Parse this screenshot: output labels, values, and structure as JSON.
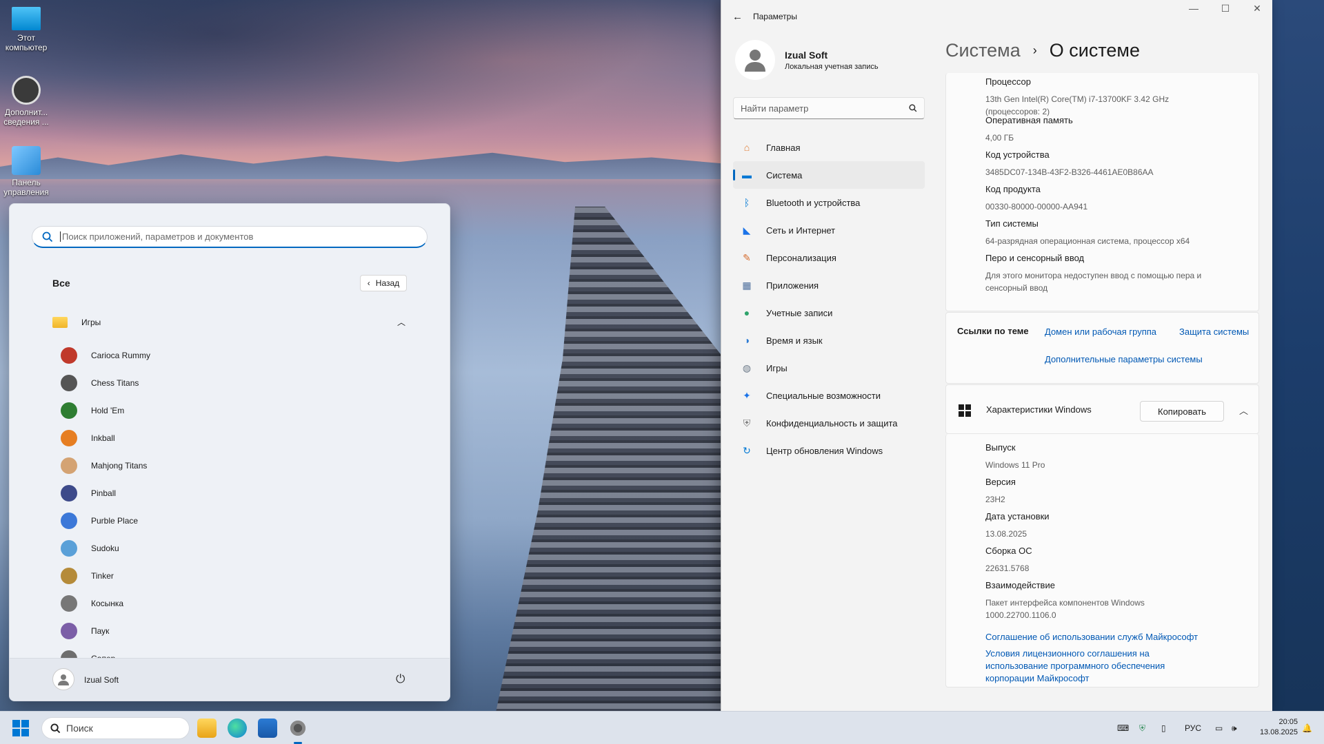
{
  "desktop": {
    "icons": [
      {
        "label": "Этот компьютер"
      },
      {
        "label": "Дополнит... сведения ..."
      },
      {
        "label": "Панель управления"
      }
    ]
  },
  "start_menu": {
    "search_placeholder": "Поиск приложений, параметров и документов",
    "all_label": "Все",
    "back_label": "Назад",
    "folder_label": "Игры",
    "games": [
      {
        "label": "Carioca Rummy",
        "color": "#c0392b"
      },
      {
        "label": "Chess Titans",
        "color": "#555555"
      },
      {
        "label": "Hold 'Em",
        "color": "#2e7d32"
      },
      {
        "label": "Inkball",
        "color": "#e67e22"
      },
      {
        "label": "Mahjong Titans",
        "color": "#d4a373"
      },
      {
        "label": "Pinball",
        "color": "#3d4a8a"
      },
      {
        "label": "Purble Place",
        "color": "#3c78d8"
      },
      {
        "label": "Sudoku",
        "color": "#5aa0d8"
      },
      {
        "label": "Tinker",
        "color": "#b58b3a"
      },
      {
        "label": "Косынка",
        "color": "#777777"
      },
      {
        "label": "Паук",
        "color": "#7b5ea7"
      },
      {
        "label": "Сапер",
        "color": "#6e6e6e"
      }
    ],
    "user_name": "Izual Soft"
  },
  "settings": {
    "window_title": "Параметры",
    "profile": {
      "name": "Izual Soft",
      "account_type": "Локальная учетная запись"
    },
    "search_placeholder": "Найти параметр",
    "nav": [
      {
        "label": "Главная",
        "icon": "home-icon",
        "glyph": "⌂",
        "color": "#e07a2f"
      },
      {
        "label": "Система",
        "icon": "system-icon",
        "glyph": "▬",
        "color": "#0078d4",
        "active": true
      },
      {
        "label": "Bluetooth и устройства",
        "icon": "bluetooth-icon",
        "glyph": "ᛒ",
        "color": "#0078d4"
      },
      {
        "label": "Сеть и Интернет",
        "icon": "wifi-icon",
        "glyph": "◣",
        "color": "#1a73e8"
      },
      {
        "label": "Персонализация",
        "icon": "brush-icon",
        "glyph": "✎",
        "color": "#d56b2d"
      },
      {
        "label": "Приложения",
        "icon": "apps-icon",
        "glyph": "▦",
        "color": "#4a6c9b"
      },
      {
        "label": "Учетные записи",
        "icon": "account-icon",
        "glyph": "●",
        "color": "#2fa36b"
      },
      {
        "label": "Время и язык",
        "icon": "globe-icon",
        "glyph": "◑",
        "color": "#2b7bd4"
      },
      {
        "label": "Игры",
        "icon": "gamepad-icon",
        "glyph": "◍",
        "color": "#6e7b8a"
      },
      {
        "label": "Специальные возможности",
        "icon": "accessibility-icon",
        "glyph": "✦",
        "color": "#1a73e8"
      },
      {
        "label": "Конфиденциальность и защита",
        "icon": "shield-icon",
        "glyph": "⛨",
        "color": "#777777"
      },
      {
        "label": "Центр обновления Windows",
        "icon": "update-icon",
        "glyph": "↻",
        "color": "#0078d4"
      }
    ],
    "breadcrumb": {
      "parent": "Система",
      "current": "О системе"
    },
    "device_specs": [
      {
        "label": "Процессор",
        "value": "13th Gen Intel(R) Core(TM) i7-13700KF   3.42 GHz (процессоров: 2)"
      },
      {
        "label": "Оперативная память",
        "value": "4,00 ГБ"
      },
      {
        "label": "Код устройства",
        "value": "3485DC07-134B-43F2-B326-4461AE0B86AA"
      },
      {
        "label": "Код продукта",
        "value": "00330-80000-00000-AA941"
      },
      {
        "label": "Тип системы",
        "value": "64-разрядная операционная система, процессор x64"
      },
      {
        "label": "Перо и сенсорный ввод",
        "value": "Для этого монитора недоступен ввод с помощью пера и сенсорный ввод"
      }
    ],
    "related_links": {
      "title": "Ссылки по теме",
      "links": [
        "Домен или рабочая группа",
        "Защита системы",
        "Дополнительные параметры системы"
      ]
    },
    "windows_specs": {
      "title": "Характеристики Windows",
      "copy_label": "Копировать",
      "items": [
        {
          "label": "Выпуск",
          "value": "Windows 11 Pro"
        },
        {
          "label": "Версия",
          "value": "23H2"
        },
        {
          "label": "Дата установки",
          "value": "13.08.2025"
        },
        {
          "label": "Сборка ОС",
          "value": "22631.5768"
        },
        {
          "label": "Взаимодействие",
          "value": "Пакет интерфейса компонентов Windows 1000.22700.1106.0"
        }
      ],
      "links": [
        "Соглашение об использовании служб Майкрософт",
        "Условия лицензионного соглашения на использование программного обеспечения корпорации Майкрософт"
      ]
    }
  },
  "taskbar": {
    "search_label": "Поиск",
    "language": "РУС",
    "time": "20:05",
    "date": "13.08.2025"
  }
}
